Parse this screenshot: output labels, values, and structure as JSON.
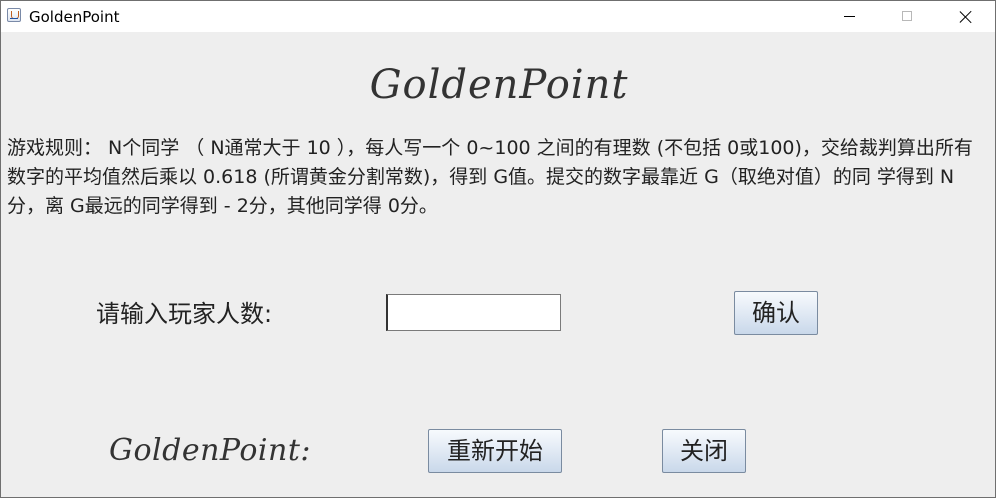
{
  "window": {
    "title": "GoldenPoint"
  },
  "titlebar_icons": {
    "app": "java-app-icon",
    "minimize": "minimize-icon",
    "maximize": "maximize-icon",
    "close": "close-icon"
  },
  "main": {
    "heading": "GoldenPoint",
    "rules_text": "游戏规则： N个同学 （ N通常大于 10 ），每人写一个 0~100 之间的有理数 (不包括 0或100)，交给裁判算出所有数字的平均值然后乘以 0.618 (所谓黄金分割常数)，得到 G值。提交的数字最靠近 G（取绝对值）的同 学得到 N分，离 G最远的同学得到 -  2分，其他同学得 0分。",
    "prompt_label": "请输入玩家人数:",
    "player_count_value": "",
    "confirm_label": "确认"
  },
  "footer": {
    "logo_text": "GoldenPoint:",
    "restart_label": "重新开始",
    "close_label": "关闭"
  },
  "colors": {
    "background": "#eeeeee",
    "titlebar": "#ffffff",
    "text": "#222222",
    "button_border": "#7a8ba0"
  }
}
